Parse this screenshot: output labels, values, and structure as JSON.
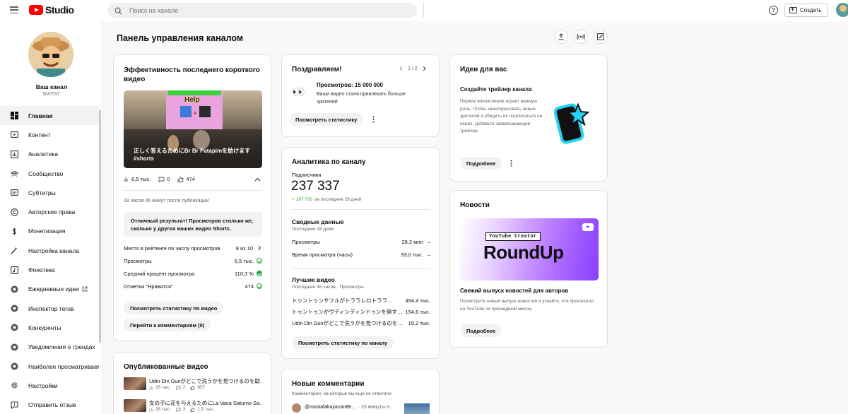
{
  "app": {
    "logo_text": "Studio",
    "search_placeholder": "Поиск на канале",
    "create_label": "Создать",
    "help_label": "?"
  },
  "sidebar": {
    "channel_name": "Ваш канал",
    "channel_handle": "SVITSY",
    "items": [
      {
        "label": "Главная",
        "icon": "dashboard-icon",
        "active": true
      },
      {
        "label": "Контент",
        "icon": "content-icon"
      },
      {
        "label": "Аналитика",
        "icon": "analytics-icon"
      },
      {
        "label": "Сообщество",
        "icon": "community-icon"
      },
      {
        "label": "Субтитры",
        "icon": "subtitles-icon"
      },
      {
        "label": "Авторские права",
        "icon": "copyright-icon"
      },
      {
        "label": "Монетизация",
        "icon": "monetization-icon"
      },
      {
        "label": "Настройка канала",
        "icon": "customization-icon"
      },
      {
        "label": "Фонотека",
        "icon": "audio-library-icon"
      },
      {
        "label": "Ежедневные идеи",
        "icon": "extension-icon"
      },
      {
        "label": "Инспектор тегов",
        "icon": "extension-icon"
      },
      {
        "label": "Конкуренты",
        "icon": "extension-icon"
      },
      {
        "label": "Уведомления о трендах",
        "icon": "extension-icon"
      },
      {
        "label": "Наиболее просматриваемые",
        "icon": "extension-icon"
      },
      {
        "label": "Настройки",
        "icon": "settings-icon"
      },
      {
        "label": "Отправить отзыв",
        "icon": "feedback-icon"
      }
    ]
  },
  "main": {
    "page_title": "Панель управления каналом",
    "short_card": {
      "title": "Эффективность последнего короткого видео",
      "thumb_overlay": "Help",
      "thumb_caption": "正しく答えるためにBr Br Patapimを助けます #shorts",
      "views": "6,5 тыс.",
      "comments": "0",
      "likes": "474",
      "since": "18 часов 46 минут после публикации",
      "banner": "Отличный результат! Просмотров столько же, сколько у других ваших видео Shorts.",
      "rows": [
        {
          "label": "Место в рейтинге по числу просмотров",
          "value": "8 из 10"
        },
        {
          "label": "Просмотры",
          "value": "6,5 тыс."
        },
        {
          "label": "Средний процент просмотра",
          "value": "110,3 %"
        },
        {
          "label": "Отметки \"Нравится\"",
          "value": "474"
        }
      ],
      "btn_stats": "Посмотреть статистику по видео",
      "btn_comments": "Перейти к комментариям (0)"
    },
    "published_card": {
      "title": "Опубликованные видео",
      "videos": [
        {
          "title": "Udin Din Dunがどこで洗うかを見つけるのを助…",
          "views": "15 тыс.",
          "comments": "2",
          "likes": "957"
        },
        {
          "title": "女の子に花を与えるためにLa Vaca Saturno Sa…",
          "views": "35 тыс.",
          "comments": "3",
          "likes": "1,5 тыс."
        }
      ]
    },
    "congrats_card": {
      "title": "Поздравляем!",
      "pager": "1 / 2",
      "milestone": "Просмотров: 15 000 000",
      "desc": "Ваши видео стали привлекать больше зрителей",
      "emoji": "👀",
      "btn": "Посмотреть статистику"
    },
    "analytics_card": {
      "title": "Аналитика по каналу",
      "subs_label": "Подписчики",
      "subs_value": "237 337",
      "subs_delta": "+ 187 720",
      "subs_period": "за последние 28 дней",
      "summary_title": "Сводные данные",
      "summary_period": "Последние 28 дней",
      "summary_rows": [
        {
          "label": "Просмотры",
          "value": "28,2 млн",
          "trend": "–"
        },
        {
          "label": "Время просмотра (часы)",
          "value": "93,0 тыс.",
          "trend": "–"
        }
      ],
      "top_title": "Лучшие видео",
      "top_period": "Последние 48 часов · Просмотры",
      "top_rows": [
        {
          "label": "トゥントゥンサフルがトララレロトララ…",
          "value": "494,4 тыс."
        },
        {
          "label": "トゥントゥンがヴディンディンドゥンを倒す…",
          "value": "154,6 тыс."
        },
        {
          "label": "Udin Din Dunがどこで洗うかを見つけるのを…",
          "value": "15,2 тыс."
        }
      ],
      "btn": "Посмотреть статистику по каналу"
    },
    "comments_card": {
      "title": "Новые комментарии",
      "subtitle": "Комментарии, на которые вы ещё не ответили",
      "author": "@mustafakayacan88…",
      "time": "· 23 минуты н…"
    },
    "ideas_card": {
      "title": "Идеи для вас",
      "heading": "Создайте трейлер канала",
      "desc": "Первое впечатление играет важную роль. Чтобы заинтересовать новых зрителей и убедить их подписаться на канал, добавьте захватывающий трейлер.",
      "btn": "Подробнее"
    },
    "news_card": {
      "title": "Новости",
      "banner_small": "YouTube Creator",
      "banner_big": "RoundUp",
      "heading": "Свежий выпуск новостей для авторов",
      "desc": "Посмотрите новый выпуск новостей и узнайте, что произошло на YouTube за прошедший месяц.",
      "btn": "Подробнее"
    }
  },
  "colors": {
    "brand_red": "#ff0000",
    "success_green": "#2ba640",
    "accent_cyan": "#21d4f3"
  }
}
